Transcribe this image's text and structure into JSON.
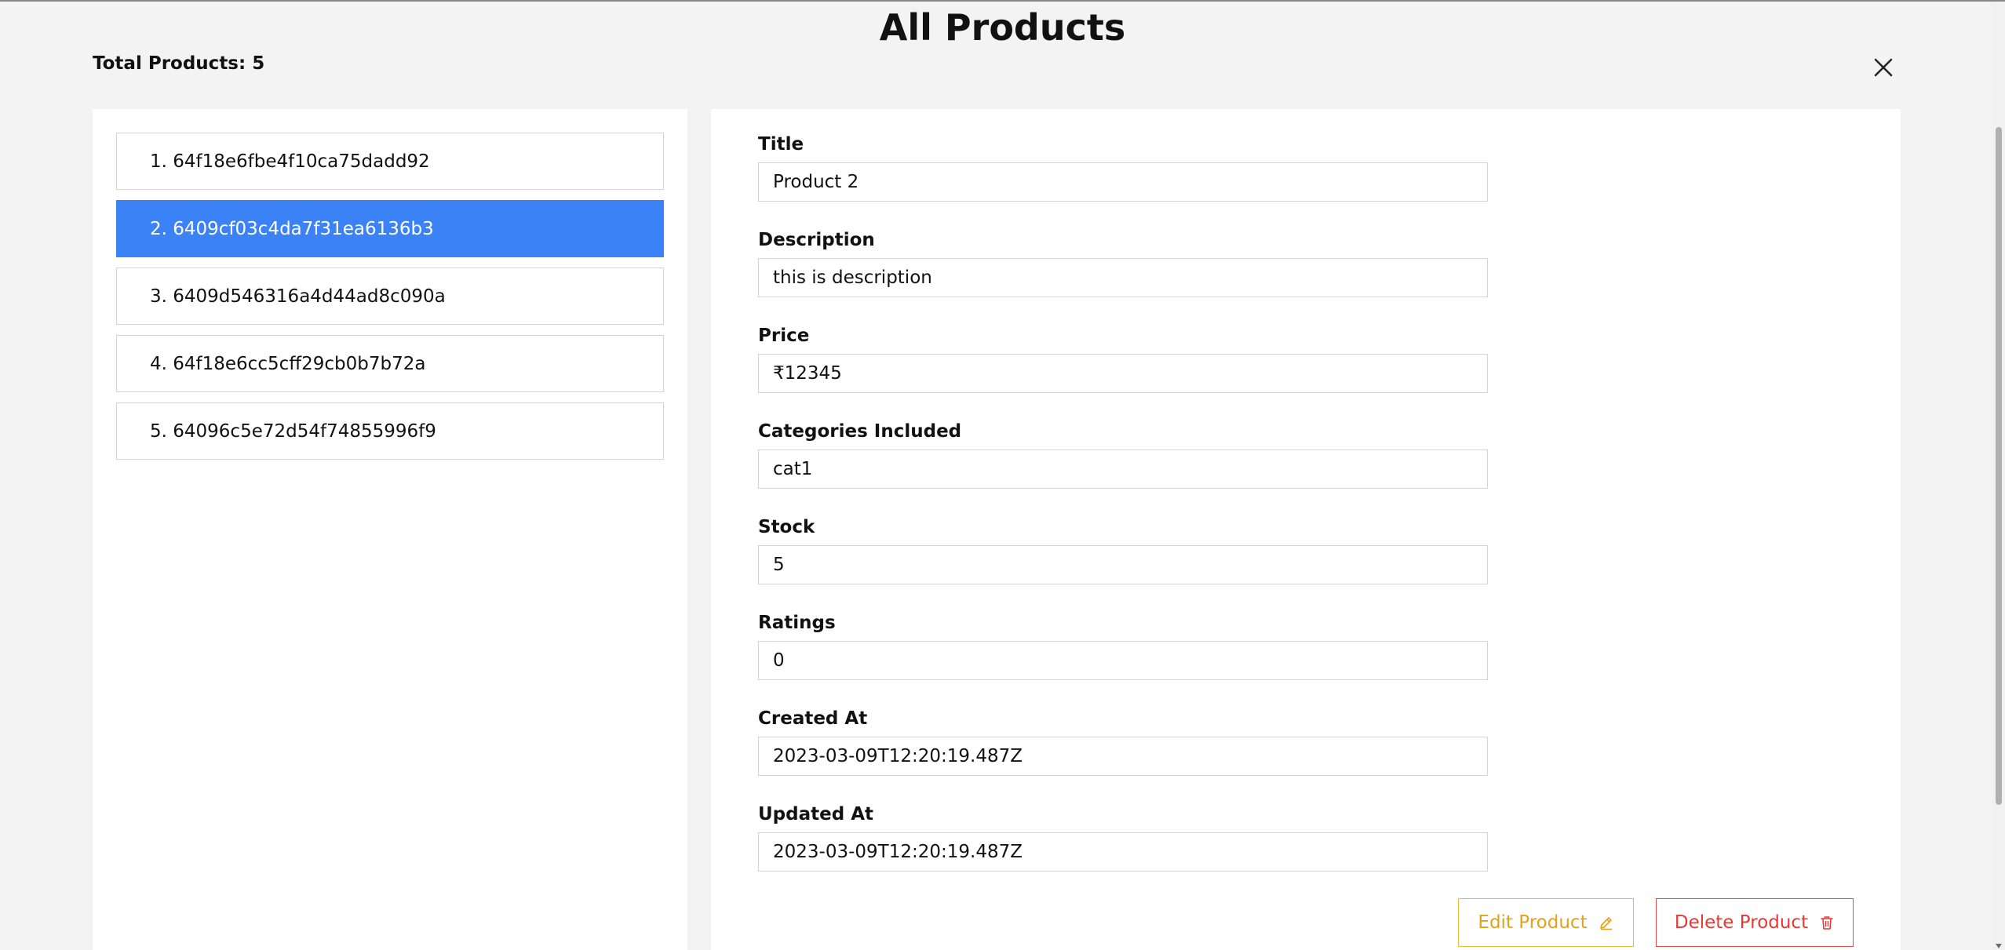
{
  "header": {
    "title": "All Products",
    "total_label": "Total Products: 5"
  },
  "products": [
    {
      "label": "1. 64f18e6fbe4f10ca75dadd92",
      "selected": false
    },
    {
      "label": "2. 6409cf03c4da7f31ea6136b3",
      "selected": true
    },
    {
      "label": "3. 6409d546316a4d44ad8c090a",
      "selected": false
    },
    {
      "label": "4. 64f18e6cc5cff29cb0b7b72a",
      "selected": false
    },
    {
      "label": "5. 64096c5e72d54f74855996f9",
      "selected": false
    }
  ],
  "details": {
    "title": {
      "label": "Title",
      "value": "Product 2"
    },
    "description": {
      "label": "Description",
      "value": "this is description"
    },
    "price": {
      "label": "Price",
      "value": "₹12345"
    },
    "categories": {
      "label": "Categories Included",
      "value": "cat1"
    },
    "stock": {
      "label": "Stock",
      "value": "5"
    },
    "ratings": {
      "label": "Ratings",
      "value": "0"
    },
    "created_at": {
      "label": "Created At",
      "value": "2023-03-09T12:20:19.487Z"
    },
    "updated_at": {
      "label": "Updated At",
      "value": "2023-03-09T12:20:19.487Z"
    }
  },
  "actions": {
    "edit_label": "Edit Product",
    "delete_label": "Delete Product"
  },
  "icons": {
    "close": "close-icon",
    "edit": "pencil-icon",
    "delete": "trash-icon"
  },
  "colors": {
    "selected": "#3b82f6",
    "edit": "#e3a21a",
    "delete": "#e53935"
  }
}
